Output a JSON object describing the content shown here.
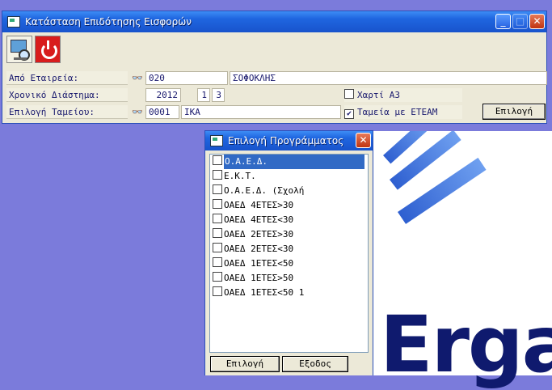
{
  "main_window": {
    "title": "Κατάσταση Επιδότησης Εισφορών",
    "minimize": "_",
    "maximize": "□",
    "close": "✕"
  },
  "form": {
    "company_label": "Από Εταιρεία:",
    "company_code": "020",
    "company_name": "ΣΟΦΟΚΛΗΣ",
    "period_label": "Χρονικό Διάστημα:",
    "period_year": "2012",
    "period_from": "1",
    "period_to": "3",
    "fund_label": "Επιλογή Ταμείου:",
    "fund_code": "0001",
    "fund_name": "ΙΚΑ",
    "paper_a3_label": "Χαρτί Α3",
    "paper_a3_checked": false,
    "eteam_label": "Ταμεία με ΕΤΕΑΜ",
    "eteam_checked": true,
    "select_button": "Επιλογή",
    "binoculars": "👓"
  },
  "dialog": {
    "title": "Επιλογή Προγράμματος",
    "close": "✕",
    "items": [
      {
        "label": "Ο.Α.Ε.Δ.",
        "selected": true
      },
      {
        "label": "Ε.Κ.Τ.",
        "selected": false
      },
      {
        "label": "Ο.Α.Ε.Δ. (Σχολή",
        "selected": false
      },
      {
        "label": "ΟΑΕΔ 4ΕΤΕΣ>30",
        "selected": false
      },
      {
        "label": "ΟΑΕΔ 4ΕΤΕΣ<30",
        "selected": false
      },
      {
        "label": "ΟΑΕΔ 2ΕΤΕΣ>30",
        "selected": false
      },
      {
        "label": "ΟΑΕΔ 2ΕΤΕΣ<30",
        "selected": false
      },
      {
        "label": "ΟΑΕΔ 1ΕΤΕΣ<50",
        "selected": false
      },
      {
        "label": "ΟΑΕΔ 1ΕΤΕΣ>50",
        "selected": false
      },
      {
        "label": "ΟΑΕΔ 1ΕΤΕΣ<50 1",
        "selected": false
      }
    ],
    "select_button": "Επιλογή",
    "exit_button": "Εξοδος"
  },
  "desktop": {
    "logo_text": "Erga"
  }
}
